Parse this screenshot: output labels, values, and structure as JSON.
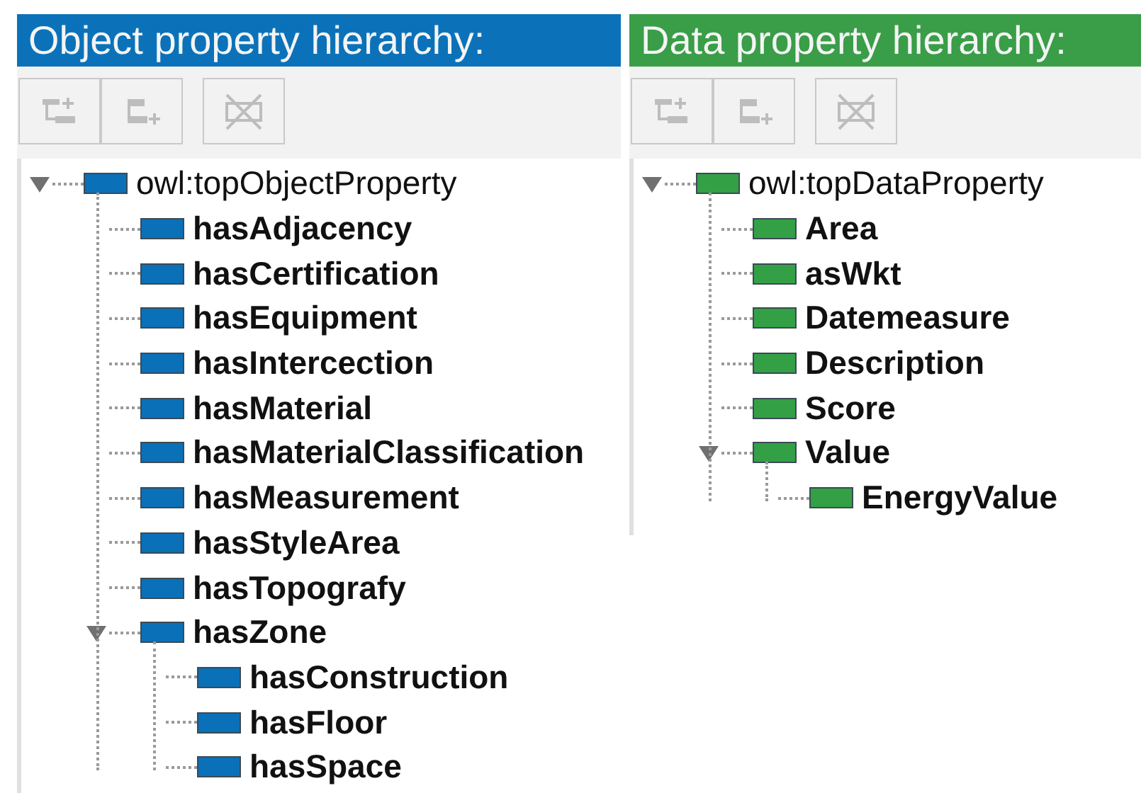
{
  "panels": [
    {
      "kind": "object",
      "title": "Object property hierarchy:",
      "toolbar": [
        {
          "kind": "add-sub",
          "disabled": true
        },
        {
          "kind": "add-sibling",
          "disabled": true
        },
        {
          "kind": "delete",
          "disabled": true
        }
      ],
      "tree": [
        {
          "label": "owl:topObjectProperty",
          "bold": false,
          "expanded": true,
          "children": [
            {
              "label": "hasAdjacency",
              "bold": true
            },
            {
              "label": "hasCertification",
              "bold": true
            },
            {
              "label": "hasEquipment",
              "bold": true
            },
            {
              "label": "hasIntercection",
              "bold": true
            },
            {
              "label": "hasMaterial",
              "bold": true
            },
            {
              "label": "hasMaterialClassification",
              "bold": true
            },
            {
              "label": "hasMeasurement",
              "bold": true
            },
            {
              "label": "hasStyleArea",
              "bold": true
            },
            {
              "label": "hasTopografy",
              "bold": true
            },
            {
              "label": "hasZone",
              "bold": true,
              "expanded": true,
              "children": [
                {
                  "label": "hasConstruction",
                  "bold": true
                },
                {
                  "label": "hasFloor",
                  "bold": true
                },
                {
                  "label": "hasSpace",
                  "bold": true
                }
              ]
            }
          ]
        }
      ]
    },
    {
      "kind": "data",
      "title": "Data property hierarchy:",
      "toolbar": [
        {
          "kind": "add-sub",
          "disabled": true
        },
        {
          "kind": "add-sibling",
          "disabled": true
        },
        {
          "kind": "delete",
          "disabled": true
        }
      ],
      "tree": [
        {
          "label": "owl:topDataProperty",
          "bold": false,
          "expanded": true,
          "children": [
            {
              "label": "Area",
              "bold": true
            },
            {
              "label": "asWkt",
              "bold": true
            },
            {
              "label": "Datemeasure",
              "bold": true
            },
            {
              "label": "Description",
              "bold": true
            },
            {
              "label": "Score",
              "bold": true
            },
            {
              "label": "Value",
              "bold": true,
              "expanded": true,
              "children": [
                {
                  "label": "EnergyValue",
                  "bold": true
                }
              ]
            }
          ]
        }
      ]
    }
  ]
}
